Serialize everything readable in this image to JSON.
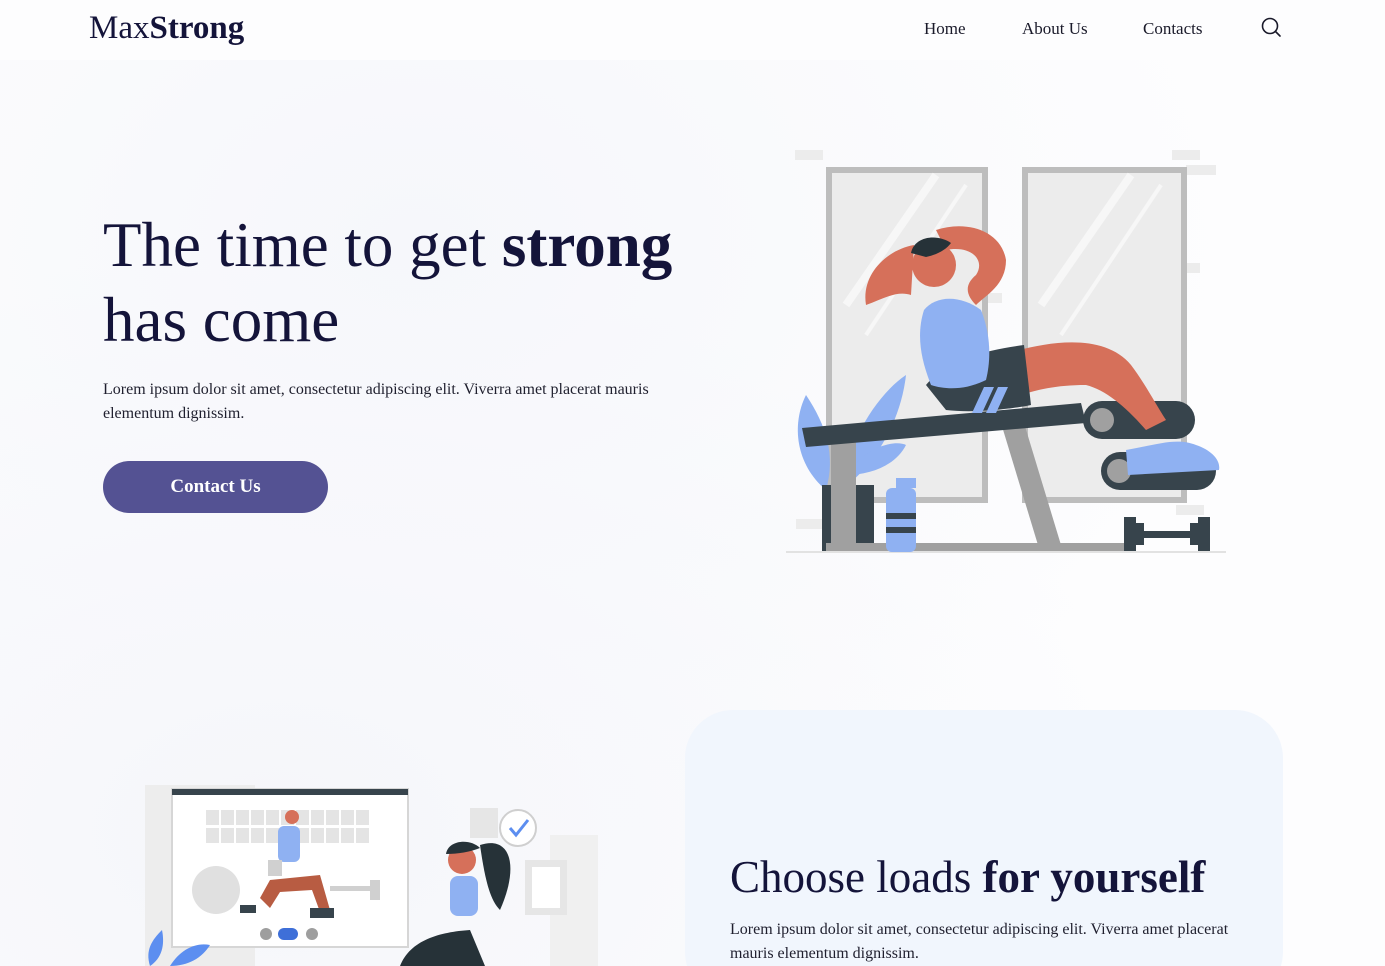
{
  "header": {
    "logo_regular": "Max",
    "logo_bold": "Strong",
    "nav": [
      {
        "label": "Home"
      },
      {
        "label": "About Us"
      },
      {
        "label": "Contacts"
      }
    ],
    "search_icon": "search-icon"
  },
  "hero": {
    "title_regular_1": "The time to get ",
    "title_bold": "strong",
    "title_regular_2": "has come",
    "text": "Lorem ipsum dolor sit amet, consectetur adipiscing elit. Viverra amet placerat mauris elementum dignissim.",
    "cta_label": "Contact Us",
    "illustration": "man-doing-situps-illustration"
  },
  "section2": {
    "title_regular": "Choose loads ",
    "title_bold": "for yourself",
    "text": "Lorem ipsum dolor sit amet, consectetur adipiscing elit. Viverra amet placerat mauris elementum dignissim.",
    "illustration": "online-workout-illustration"
  },
  "colors": {
    "accent": "#545293",
    "heading": "#14143a",
    "card_bg": "#f1f6fd",
    "skin": "#d6705a",
    "blue": "#8fb1f2",
    "dark": "#37444c"
  }
}
